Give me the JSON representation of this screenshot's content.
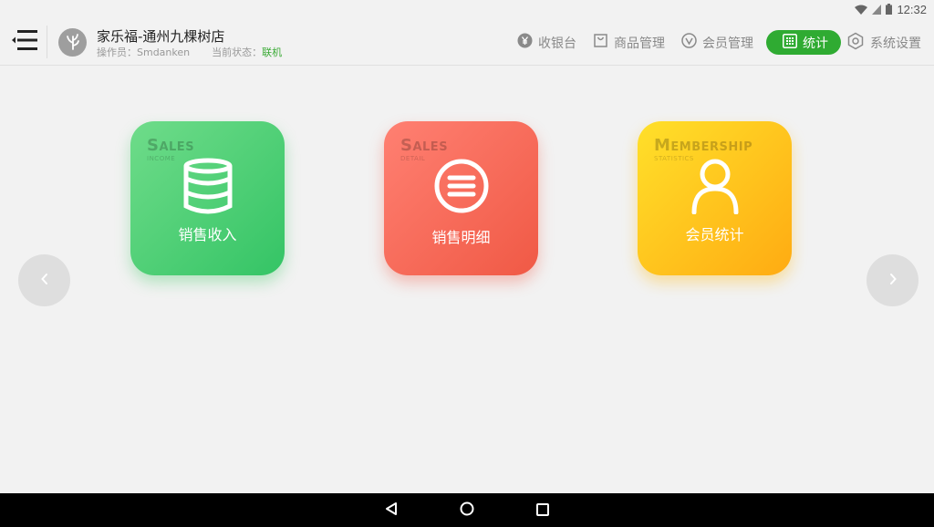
{
  "status_bar": {
    "time": "12:32"
  },
  "header": {
    "store_name": "家乐福-通州九棵树店",
    "operator_label": "操作员：",
    "operator_name": "Smdanken",
    "state_label": "当前状态：",
    "state_value": "联机"
  },
  "nav": [
    {
      "label": "收银台",
      "icon": "yen-circle-icon",
      "active": false
    },
    {
      "label": "商品管理",
      "icon": "shopping-bag-icon",
      "active": false
    },
    {
      "label": "会员管理",
      "icon": "v-circle-icon",
      "active": false
    },
    {
      "label": "统计",
      "icon": "grid-calculator-icon",
      "active": true
    },
    {
      "label": "系统设置",
      "icon": "hexagon-gear-icon",
      "active": false
    }
  ],
  "tiles": [
    {
      "label": "销售收入",
      "watermark": "Sales",
      "watermark_sub": "INCOME",
      "icon": "database-icon",
      "color": "#34c465"
    },
    {
      "label": "销售明细",
      "watermark": "Sales",
      "watermark_sub": "DETAIL",
      "icon": "list-circle-icon",
      "color": "#f05945"
    },
    {
      "label": "会员统计",
      "watermark": "Membership",
      "watermark_sub": "STATISTICS",
      "icon": "user-icon",
      "color": "#ffab12"
    }
  ],
  "colors": {
    "accent": "#2fab32",
    "background": "#f2f2f2",
    "muted_text": "#888888"
  }
}
